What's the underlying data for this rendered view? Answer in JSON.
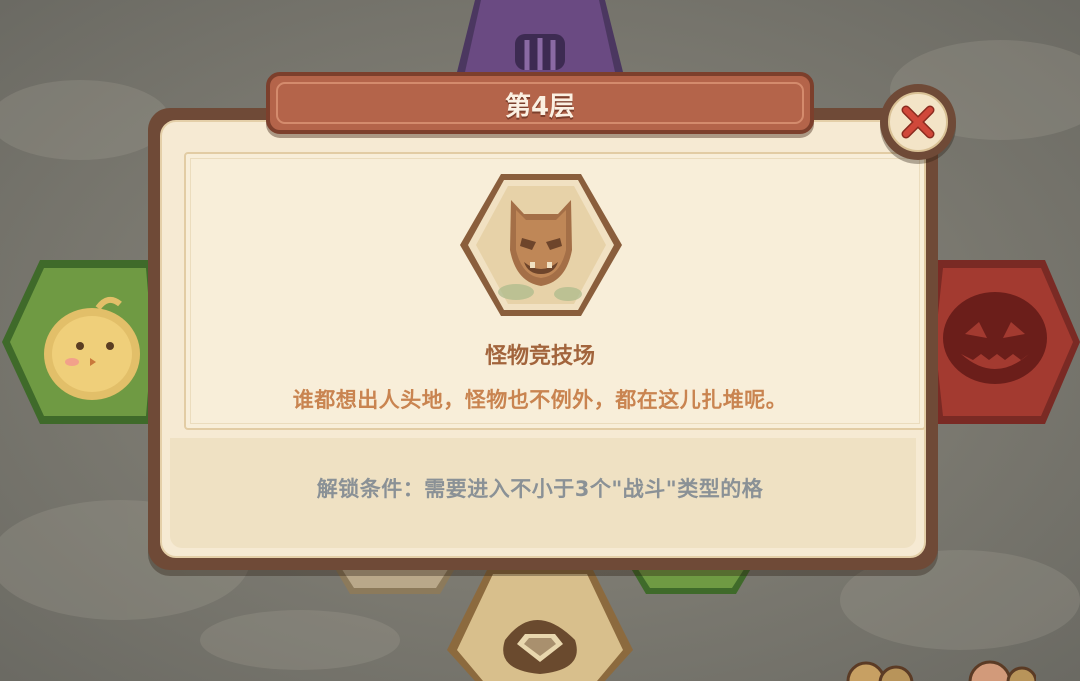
{
  "dialog": {
    "title": "第4层",
    "close_icon": "close-x-icon",
    "stage_icon": "monster-mask-icon",
    "stage_name": "怪物竞技场",
    "stage_description": "谁都想出人头地，怪物也不例外，都在这儿扎堆呢。",
    "unlock_condition": "解锁条件：需要进入不小于3个\"战斗\"类型的格"
  },
  "map": {
    "tiles": [
      {
        "name": "purple-cage-tile",
        "icon": "cage-icon",
        "color": "#6a4a82"
      },
      {
        "name": "green-chick-tile",
        "icon": "chick-icon",
        "color": "#5c8a3a"
      },
      {
        "name": "red-monster-tile",
        "icon": "pumpkin-monster-icon",
        "color": "#a33a30"
      },
      {
        "name": "bottom-treasure-tile",
        "icon": "diamond-bag-icon",
        "color": "#c9a871"
      },
      {
        "name": "bottom-left-tile",
        "icon": "",
        "color": "#b9a88a"
      },
      {
        "name": "bottom-right-green-tile",
        "icon": "",
        "color": "#5c8a3a"
      }
    ],
    "player_avatars": [
      "player-avatar-icon",
      "player-avatar-icon"
    ]
  },
  "colors": {
    "panel_frame": "#6f4a37",
    "panel_fill": "#f6ead3",
    "banner": "#b4644a",
    "close_x": "#c8412f"
  }
}
